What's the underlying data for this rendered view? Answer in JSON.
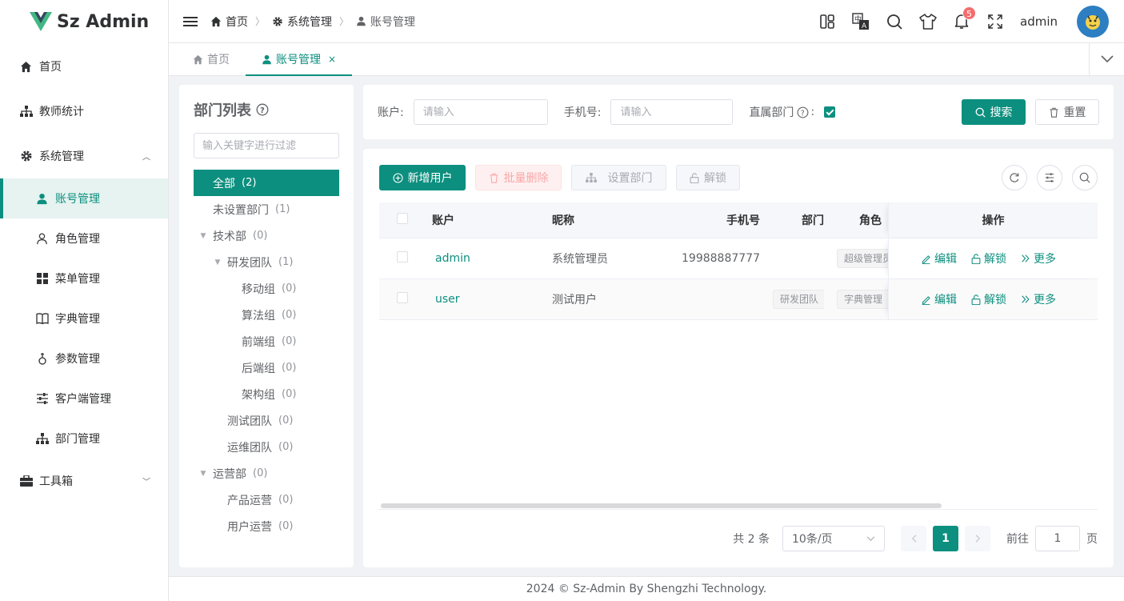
{
  "app": {
    "name": "Sz Admin",
    "brand_color": "#0d8f7f"
  },
  "sidebar": {
    "items": [
      {
        "label": "首页",
        "icon": "home-icon"
      },
      {
        "label": "教师统计",
        "icon": "org-chart-icon"
      },
      {
        "label": "系统管理",
        "icon": "gear-icon",
        "expanded": true
      },
      {
        "label": "账号管理",
        "icon": "user-icon",
        "active": true
      },
      {
        "label": "角色管理",
        "icon": "user-outline-icon"
      },
      {
        "label": "菜单管理",
        "icon": "grid-icon"
      },
      {
        "label": "字典管理",
        "icon": "book-icon"
      },
      {
        "label": "参数管理",
        "icon": "param-icon"
      },
      {
        "label": "客户端管理",
        "icon": "sliders-icon"
      },
      {
        "label": "部门管理",
        "icon": "org-chart-icon"
      },
      {
        "label": "工具箱",
        "icon": "briefcase-icon",
        "expanded": false
      }
    ]
  },
  "header": {
    "breadcrumb": [
      "首页",
      "系统管理",
      "账号管理"
    ],
    "notification_count": "5",
    "username": "admin"
  },
  "tabs": [
    {
      "label": "首页",
      "active": false
    },
    {
      "label": "账号管理",
      "active": true,
      "close": "×"
    }
  ],
  "dept": {
    "title": "部门列表",
    "filter_placeholder": "输入关键字进行过滤",
    "nodes": [
      {
        "label": "全部",
        "count": "(2)",
        "selected": true
      },
      {
        "label": "未设置部门",
        "count": "(1)"
      },
      {
        "label": "技术部",
        "count": "(0)"
      },
      {
        "label": "研发团队",
        "count": "(1)"
      },
      {
        "label": "移动组",
        "count": "(0)"
      },
      {
        "label": "算法组",
        "count": "(0)"
      },
      {
        "label": "前端组",
        "count": "(0)"
      },
      {
        "label": "后端组",
        "count": "(0)"
      },
      {
        "label": "架构组",
        "count": "(0)"
      },
      {
        "label": "测试团队",
        "count": "(0)"
      },
      {
        "label": "运维团队",
        "count": "(0)"
      },
      {
        "label": "运营部",
        "count": "(0)"
      },
      {
        "label": "产品运营",
        "count": "(0)"
      },
      {
        "label": "用户运营",
        "count": "(0)"
      }
    ]
  },
  "search": {
    "account_label": "账户:",
    "account_placeholder": "请输入",
    "phone_label": "手机号:",
    "phone_placeholder": "请输入",
    "direct_dept_label": "直属部门",
    "colon": ":",
    "direct_dept_checked": true,
    "search_button": "搜索",
    "reset_button": "重置"
  },
  "toolbar": {
    "add_user": "新增用户",
    "batch_delete": "批量删除",
    "set_dept": "设置部门",
    "unlock": "解锁"
  },
  "table": {
    "columns": [
      "账户",
      "昵称",
      "手机号",
      "部门",
      "角色",
      "操作"
    ],
    "rows": [
      {
        "account": "admin",
        "nickname": "系统管理员",
        "phone": "19988887777",
        "dept": "",
        "role": "超级管理员"
      },
      {
        "account": "user",
        "nickname": "测试用户",
        "phone": "",
        "dept": "研发团队",
        "role": "字典管理"
      }
    ],
    "actions": {
      "edit": "编辑",
      "unlock": "解锁",
      "more": "更多"
    }
  },
  "pagination": {
    "total_text": "共 2 条",
    "page_size": "10条/页",
    "current_page": "1",
    "goto_label": "前往",
    "goto_value": "1",
    "page_suffix": "页"
  },
  "footer": {
    "text": "2024 © Sz-Admin By Shengzhi Technology."
  }
}
